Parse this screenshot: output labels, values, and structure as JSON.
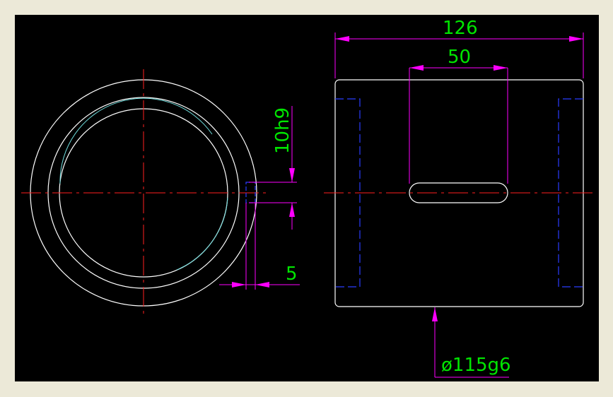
{
  "colors": {
    "background": "#000000",
    "frame": "#e6e3d6",
    "outline": "#ffffff",
    "centerline": "#ff2020",
    "dimension": "#ff00ff",
    "dimension_text": "#00e600",
    "hidden": "#2a3cff",
    "thread": "#6fdcdc"
  },
  "dimensions": {
    "overall_length": "126",
    "slot_width": "50",
    "key_height": "10h9",
    "key_width": "5",
    "diameter": "ø115g6"
  }
}
